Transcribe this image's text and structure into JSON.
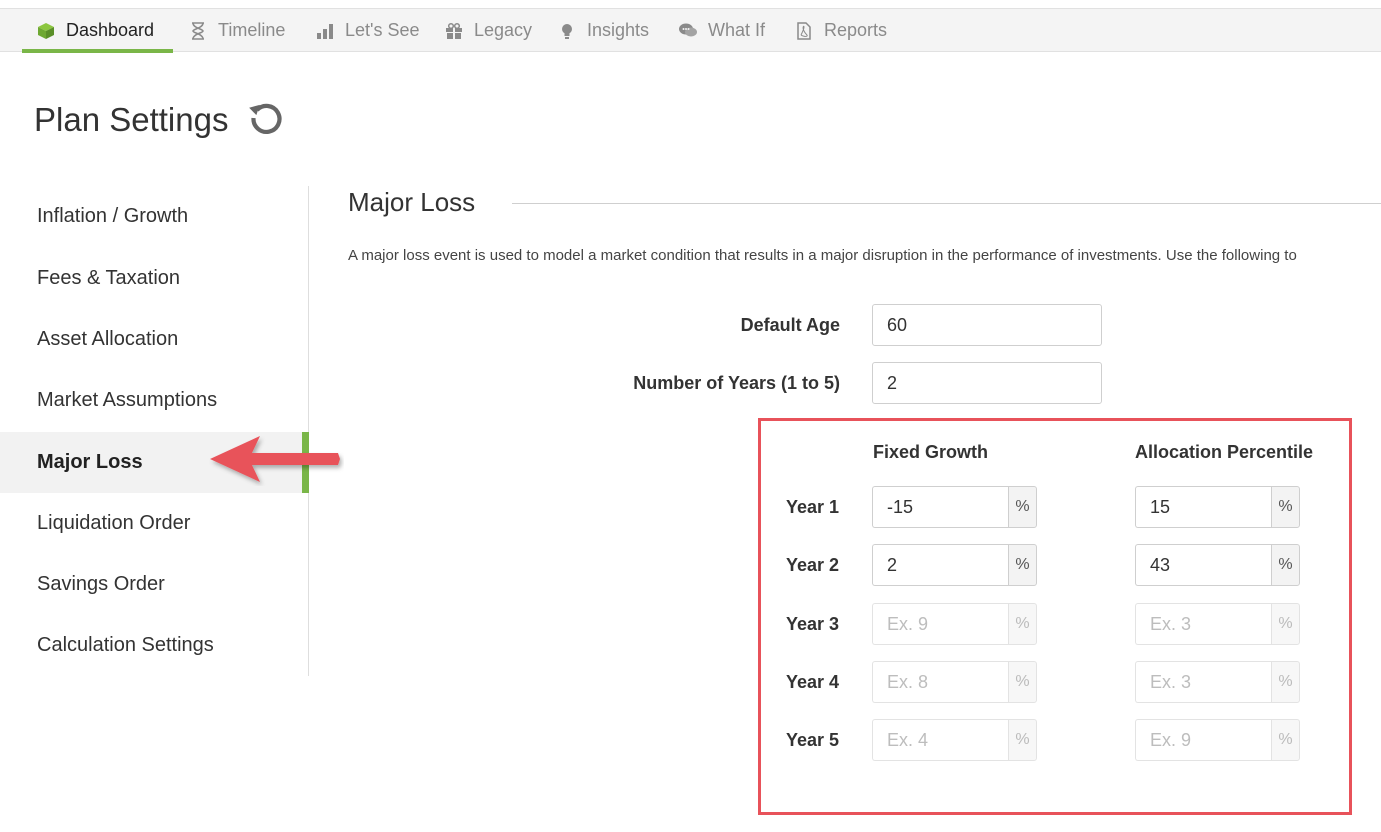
{
  "nav": {
    "tabs": [
      {
        "label": "Dashboard",
        "icon": "cube-icon",
        "active": true
      },
      {
        "label": "Timeline",
        "icon": "hourglass-icon",
        "active": false
      },
      {
        "label": "Let's See",
        "icon": "bar-chart-icon",
        "active": false
      },
      {
        "label": "Legacy",
        "icon": "gift-icon",
        "active": false
      },
      {
        "label": "Insights",
        "icon": "lightbulb-icon",
        "active": false
      },
      {
        "label": "What If",
        "icon": "chat-icon",
        "active": false
      },
      {
        "label": "Reports",
        "icon": "pdf-file-icon",
        "active": false
      }
    ],
    "accent_color": "#7ab648"
  },
  "header": {
    "title": "Plan Settings",
    "reset_icon": "refresh-icon"
  },
  "sidebar": {
    "items": [
      {
        "label": "Inflation / Growth",
        "active": false
      },
      {
        "label": "Fees & Taxation",
        "active": false
      },
      {
        "label": "Asset Allocation",
        "active": false
      },
      {
        "label": "Market Assumptions",
        "active": false
      },
      {
        "label": "Major Loss",
        "active": true
      },
      {
        "label": "Liquidation Order",
        "active": false
      },
      {
        "label": "Savings Order",
        "active": false
      },
      {
        "label": "Calculation Settings",
        "active": false
      }
    ]
  },
  "major_loss": {
    "title": "Major Loss",
    "description": "A major loss event is used to model a market condition that results in a major disruption in the performance of investments. Use the following to",
    "default_age": {
      "label": "Default Age",
      "value": "60"
    },
    "num_years": {
      "label": "Number of Years (1 to 5)",
      "value": "2"
    },
    "col_fixed": "Fixed Growth",
    "col_alloc": "Allocation Percentile",
    "unit": "%",
    "years": [
      {
        "label": "Year 1",
        "fixed": "-15",
        "fixed_ph": "",
        "alloc": "15",
        "alloc_ph": ""
      },
      {
        "label": "Year 2",
        "fixed": "2",
        "fixed_ph": "",
        "alloc": "43",
        "alloc_ph": ""
      },
      {
        "label": "Year 3",
        "fixed": "",
        "fixed_ph": "Ex. 9",
        "alloc": "",
        "alloc_ph": "Ex. 3"
      },
      {
        "label": "Year 4",
        "fixed": "",
        "fixed_ph": "Ex. 8",
        "alloc": "",
        "alloc_ph": "Ex. 3"
      },
      {
        "label": "Year 5",
        "fixed": "",
        "fixed_ph": "Ex. 4",
        "alloc": "",
        "alloc_ph": "Ex. 9"
      }
    ],
    "highlight_color": "#e8525a"
  }
}
